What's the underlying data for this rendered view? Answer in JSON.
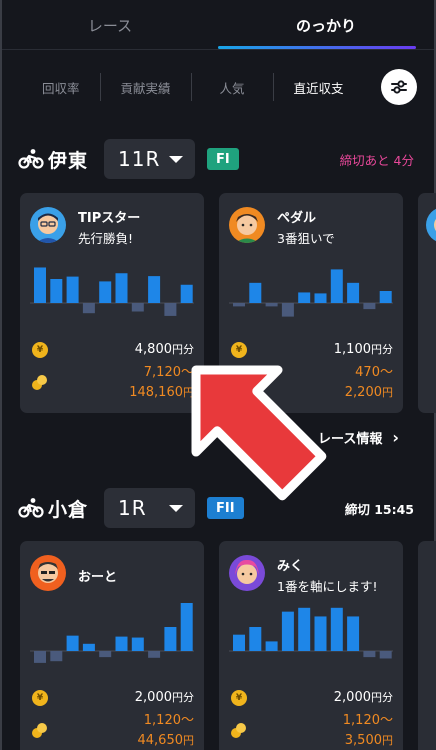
{
  "tabs": [
    {
      "label": "レース",
      "active": false
    },
    {
      "label": "のっかり",
      "active": true
    }
  ],
  "filters": [
    {
      "label": "回収率",
      "active": false
    },
    {
      "label": "貢献実績",
      "active": false
    },
    {
      "label": "人気",
      "active": false
    },
    {
      "label": "直近収支",
      "active": true
    }
  ],
  "settings_icon": "sliders-icon",
  "races": [
    {
      "venue": "伊東",
      "race_number": "11R",
      "grade": "FI",
      "grade_color": "#1fa27e",
      "deadline": "締切あと 4分",
      "deadline_color": "#e8489a",
      "cards": [
        {
          "name": "TIPスター",
          "comment": "先行勝負!",
          "bars": [
            0.74,
            0.5,
            0.55,
            -0.3,
            0.45,
            0.62,
            -0.25,
            0.56,
            -0.38,
            0.38
          ],
          "bet_amount": "4,800",
          "bet_unit": "円分",
          "return_low": "7,120",
          "return_high": "148,160",
          "return_unit": "円"
        },
        {
          "name": "ペダル",
          "comment": "3番狙いで",
          "bars": [
            -0.1,
            0.42,
            -0.1,
            -0.4,
            0.22,
            0.2,
            0.7,
            0.42,
            -0.18,
            0.25
          ],
          "bet_amount": "1,100",
          "bet_unit": "円分",
          "return_low": "470",
          "return_high": "2,200",
          "return_unit": "円"
        }
      ],
      "race_info_label": "レース情報"
    },
    {
      "venue": "小倉",
      "race_number": "1R",
      "grade": "FII",
      "grade_color": "#1d7fd1",
      "deadline": "締切 15:45",
      "deadline_color": "#ffffff",
      "cards": [
        {
          "name": "おーと",
          "comment": "",
          "bars": [
            -0.35,
            -0.3,
            0.32,
            0.15,
            -0.18,
            0.3,
            0.28,
            -0.2,
            0.5,
            1.0
          ],
          "bet_amount": "2,000",
          "bet_unit": "円分",
          "return_low": "1,120",
          "return_high": "44,650",
          "return_unit": "円"
        },
        {
          "name": "みく",
          "comment": "1番を軸にします!",
          "bars": [
            0.34,
            0.5,
            0.2,
            0.82,
            0.9,
            0.72,
            0.9,
            0.72,
            -0.18,
            -0.22
          ],
          "bet_amount": "2,000",
          "bet_unit": "円分",
          "return_low": "1,120",
          "return_high": "3,500",
          "return_unit": "円"
        }
      ]
    }
  ],
  "colors": {
    "bar_positive": "#1e86e8",
    "bar_negative": "#4a5a7c",
    "return_text": "#f08a22",
    "arrow": "#e8393b"
  }
}
